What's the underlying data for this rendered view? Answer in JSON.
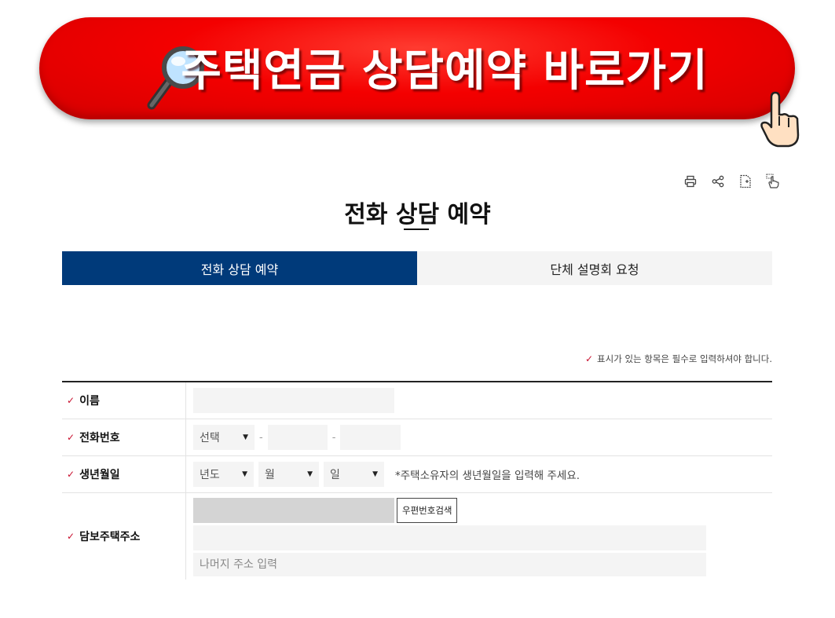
{
  "banner": {
    "text": "주택연금 상담예약 바로가기",
    "bg_color": "#f40000",
    "icons": [
      "magnifier-icon",
      "pointing-hand-icon"
    ]
  },
  "toolbar": {
    "icons": [
      "print-icon",
      "share-icon",
      "document-icon",
      "hand-cursor-icon"
    ]
  },
  "page": {
    "title": "전화 상담 예약"
  },
  "tabs": [
    {
      "label": "전화 상담 예약",
      "active": true
    },
    {
      "label": "단체 설명회 요청",
      "active": false
    }
  ],
  "colors": {
    "accent": "#003a7a",
    "required_mark": "#c8102e"
  },
  "required_note": "표시가 있는 항목은 필수로 입력하셔야 합니다.",
  "form": {
    "name": {
      "label": "이름",
      "value": ""
    },
    "phone": {
      "label": "전화번호",
      "prefix_selected": "선택",
      "separator": "-",
      "middle": "",
      "last": ""
    },
    "birth": {
      "label": "생년월일",
      "year_selected": "년도",
      "month_selected": "월",
      "day_selected": "일",
      "hint": "*주택소유자의 생년월일을 입력해 주세요."
    },
    "address": {
      "label": "담보주택주소",
      "zip_value": "",
      "zip_button": "우편번호검색",
      "address1": "",
      "address2_placeholder": "나머지 주소 입력"
    }
  }
}
